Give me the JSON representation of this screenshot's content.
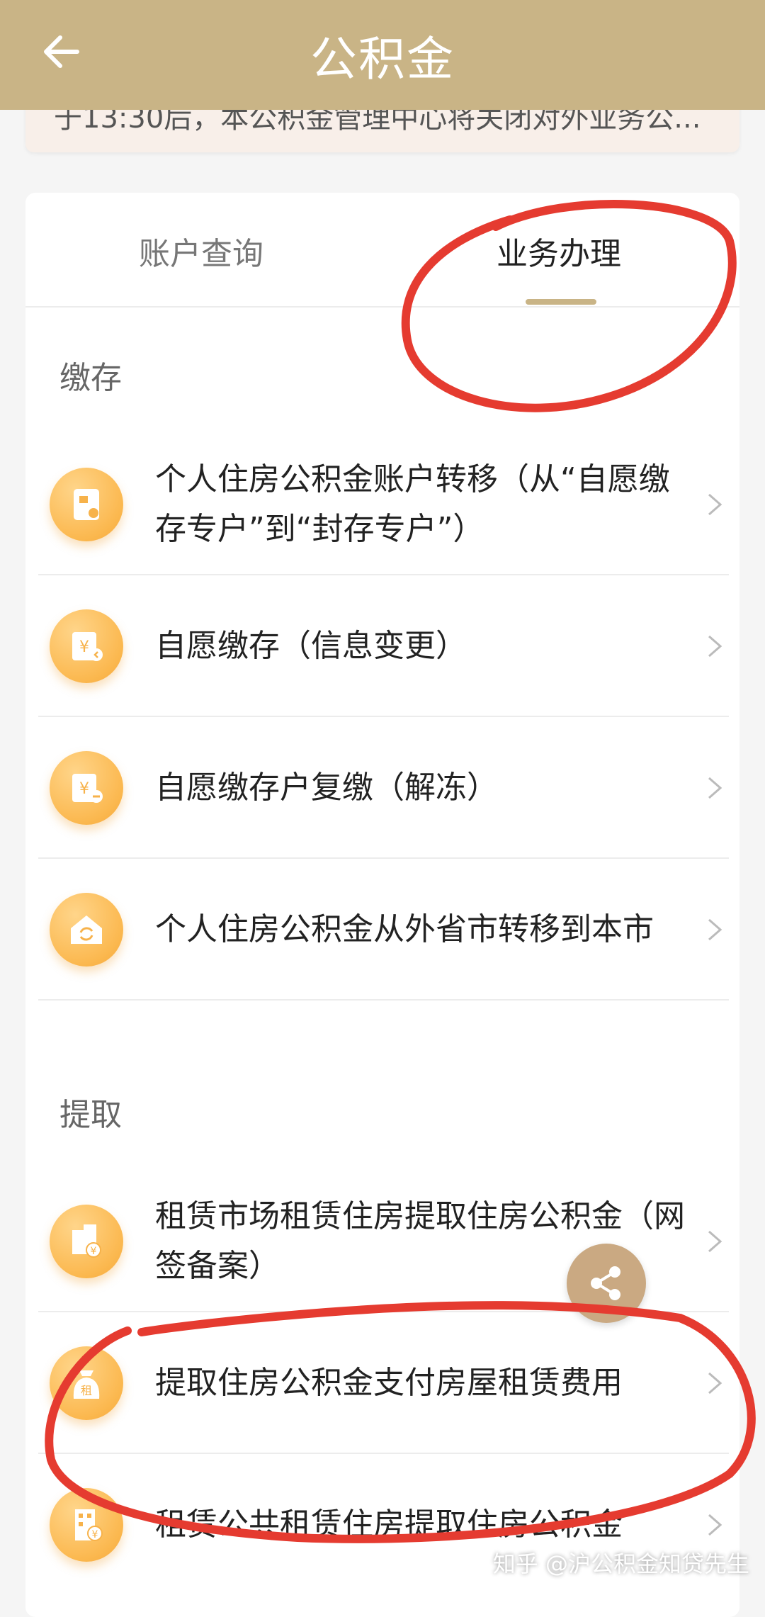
{
  "header": {
    "title": "公积金",
    "back_icon": "arrow-left-icon"
  },
  "notice": {
    "text": "于13:30后，本公积金管理中心将关闭对外业务公..."
  },
  "tabs": [
    {
      "label": "账户查询",
      "active": false
    },
    {
      "label": "业务办理",
      "active": true
    }
  ],
  "sections": [
    {
      "title": "缴存",
      "items": [
        {
          "label": "个人住房公积金账户转移（从“自愿缴存专户”到“封存专户”）",
          "icon": "account-transfer-icon"
        },
        {
          "label": "自愿缴存（信息变更）",
          "icon": "yuan-document-icon"
        },
        {
          "label": "自愿缴存户复缴（解冻）",
          "icon": "yuan-document-minus-icon"
        },
        {
          "label": "个人住房公积金从外省市转移到本市",
          "icon": "house-refresh-icon"
        }
      ]
    },
    {
      "title": "提取",
      "items": [
        {
          "label": "租赁市场租赁住房提取住房公积金（网签备案）",
          "icon": "building-yuan-icon"
        },
        {
          "label": "提取住房公积金支付房屋租赁费用",
          "icon": "rent-bag-icon",
          "icon_text": "租"
        },
        {
          "label": "租赁公共租赁住房提取住房公积金",
          "icon": "public-building-yuan-icon"
        }
      ]
    }
  ],
  "share": {
    "icon": "share-icon"
  },
  "watermark": "知乎 @沪公积金知贷先生",
  "colors": {
    "header_bg": "#c9b486",
    "accent": "#c9b486",
    "icon_orange": "#fbb84f",
    "annotation_red": "#e53b30"
  }
}
